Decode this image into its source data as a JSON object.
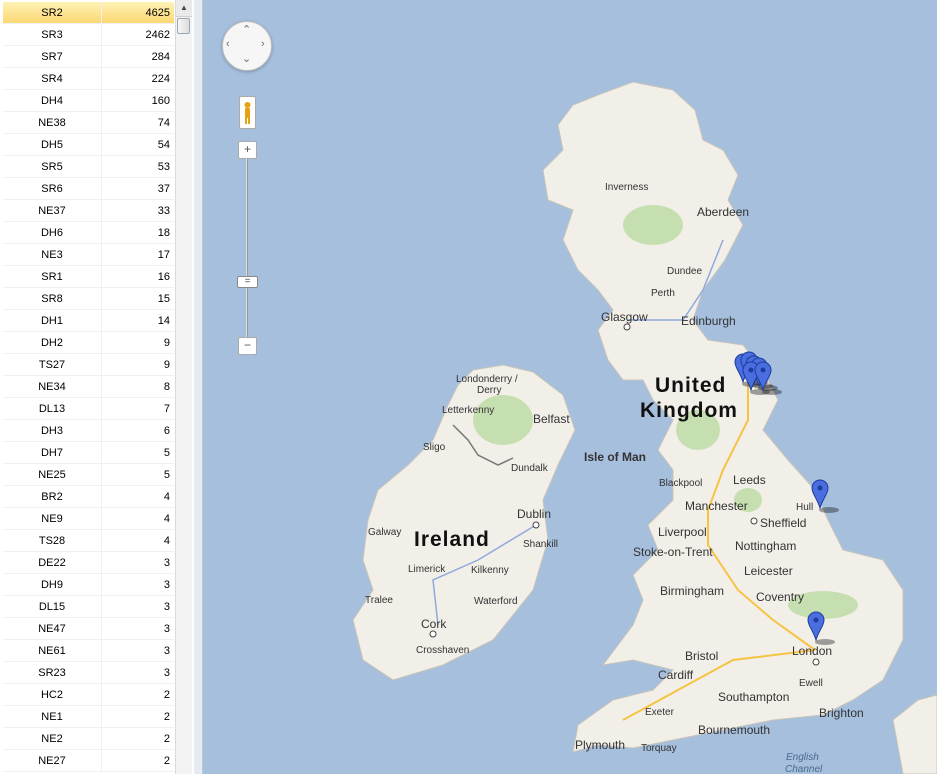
{
  "postcode_list": [
    {
      "postcode": "SR2",
      "count": "4625"
    },
    {
      "postcode": "SR3",
      "count": "2462"
    },
    {
      "postcode": "SR7",
      "count": "284"
    },
    {
      "postcode": "SR4",
      "count": "224"
    },
    {
      "postcode": "DH4",
      "count": "160"
    },
    {
      "postcode": "NE38",
      "count": "74"
    },
    {
      "postcode": "DH5",
      "count": "54"
    },
    {
      "postcode": "SR5",
      "count": "53"
    },
    {
      "postcode": "SR6",
      "count": "37"
    },
    {
      "postcode": "NE37",
      "count": "33"
    },
    {
      "postcode": "DH6",
      "count": "18"
    },
    {
      "postcode": "NE3",
      "count": "17"
    },
    {
      "postcode": "SR1",
      "count": "16"
    },
    {
      "postcode": "SR8",
      "count": "15"
    },
    {
      "postcode": "DH1",
      "count": "14"
    },
    {
      "postcode": "DH2",
      "count": "9"
    },
    {
      "postcode": "TS27",
      "count": "9"
    },
    {
      "postcode": "NE34",
      "count": "8"
    },
    {
      "postcode": "DL13",
      "count": "7"
    },
    {
      "postcode": "DH3",
      "count": "6"
    },
    {
      "postcode": "DH7",
      "count": "5"
    },
    {
      "postcode": "NE25",
      "count": "5"
    },
    {
      "postcode": "BR2",
      "count": "4"
    },
    {
      "postcode": "NE9",
      "count": "4"
    },
    {
      "postcode": "TS28",
      "count": "4"
    },
    {
      "postcode": "DE22",
      "count": "3"
    },
    {
      "postcode": "DH9",
      "count": "3"
    },
    {
      "postcode": "DL15",
      "count": "3"
    },
    {
      "postcode": "NE47",
      "count": "3"
    },
    {
      "postcode": "NE61",
      "count": "3"
    },
    {
      "postcode": "SR23",
      "count": "3"
    },
    {
      "postcode": "HC2",
      "count": "2"
    },
    {
      "postcode": "NE1",
      "count": "2"
    },
    {
      "postcode": "NE2",
      "count": "2"
    },
    {
      "postcode": "NE27",
      "count": "2"
    }
  ],
  "selected_index": 0,
  "map": {
    "countries": {
      "uk_line1": "United",
      "uk_line2": "Kingdom",
      "ireland": "Ireland"
    },
    "seas": {
      "english_channel_1": "English",
      "english_channel_2": "Channel"
    },
    "places": {
      "inverness": "Inverness",
      "aberdeen": "Aberdeen",
      "dundee": "Dundee",
      "perth": "Perth",
      "glasgow": "Glasgow",
      "edinburgh": "Edinburgh",
      "londonderry": "Londonderry /",
      "derry": "Derry",
      "letterkenny": "Letterkenny",
      "belfast": "Belfast",
      "sligo": "Sligo",
      "dundalk": "Dundalk",
      "isle_of_man": "Isle of Man",
      "blackpool": "Blackpool",
      "leeds": "Leeds",
      "hull": "Hull",
      "manchester": "Manchester",
      "sheffield": "Sheffield",
      "liverpool": "Liverpool",
      "dublin": "Dublin",
      "galway": "Galway",
      "shankill": "Shankill",
      "stoke": "Stoke-on-Trent",
      "nottingham": "Nottingham",
      "limerick": "Limerick",
      "kilkenny": "Kilkenny",
      "leicester": "Leicester",
      "birmingham": "Birmingham",
      "coventry": "Coventry",
      "tralee": "Tralee",
      "waterford": "Waterford",
      "cork": "Cork",
      "crosshaven": "Crosshaven",
      "london": "London",
      "bristol": "Bristol",
      "ewell": "Ewell",
      "cardiff": "Cardiff",
      "southampton": "Southampton",
      "exeter": "Exeter",
      "brighton": "Brighton",
      "bournemouth": "Bournemouth",
      "plymouth": "Plymouth",
      "torquay": "Torquay"
    },
    "marker_color": "#4a6ee0",
    "land_color": "#f2efe9",
    "water_color": "#a5bfdd",
    "park_color": "#c6dfb0"
  },
  "controls": {
    "pan_icon": "pan-arrows-icon",
    "pegman_icon": "pegman-icon",
    "zoom_in": "+",
    "zoom_out": "−",
    "zoom_handle": "="
  }
}
